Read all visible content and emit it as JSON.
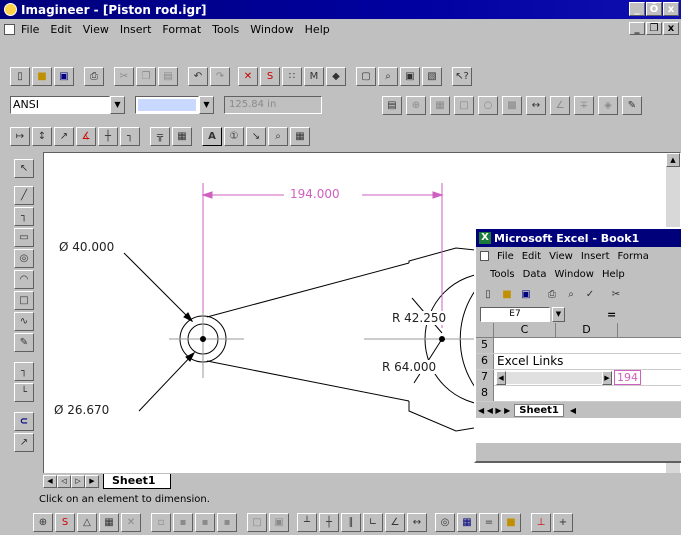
{
  "app": {
    "title": "Imagineer - [Piston rod.igr]",
    "min": "_",
    "restore": "Ő",
    "close": "x"
  },
  "menu": [
    "File",
    "Edit",
    "View",
    "Insert",
    "Format",
    "Tools",
    "Window",
    "Help"
  ],
  "toolbar2": {
    "style_value": "ANSI",
    "line_value": "",
    "size_value": "125.84 in"
  },
  "toolbar3": {
    "text_button": "A"
  },
  "drawing": {
    "dim_top": "194.000",
    "dim_dia1": "Ø 40.000",
    "dim_dia2": "Ø 26.670",
    "dim_r1": "R 42.250",
    "dim_r2": "R 64.000"
  },
  "sheet_tab": "Sheet1",
  "status": "Click on an element to dimension.",
  "excel": {
    "title": "Microsoft Excel - Book1",
    "menu1": [
      "File",
      "Edit",
      "View",
      "Insert",
      "Forma"
    ],
    "menu2": [
      "Tools",
      "Data",
      "Window",
      "Help"
    ],
    "name_box": "E7",
    "equals": "=",
    "columns": [
      "C",
      "D"
    ],
    "rows": [
      "5",
      "6",
      "7",
      "8"
    ],
    "cell_text": "Excel Links",
    "cell_value": "194",
    "sheet_tab": "Sheet1"
  },
  "colors": {
    "titlebar": "#00007b",
    "dimension": "#d060c0",
    "excel_titlebar": "#00007b"
  }
}
